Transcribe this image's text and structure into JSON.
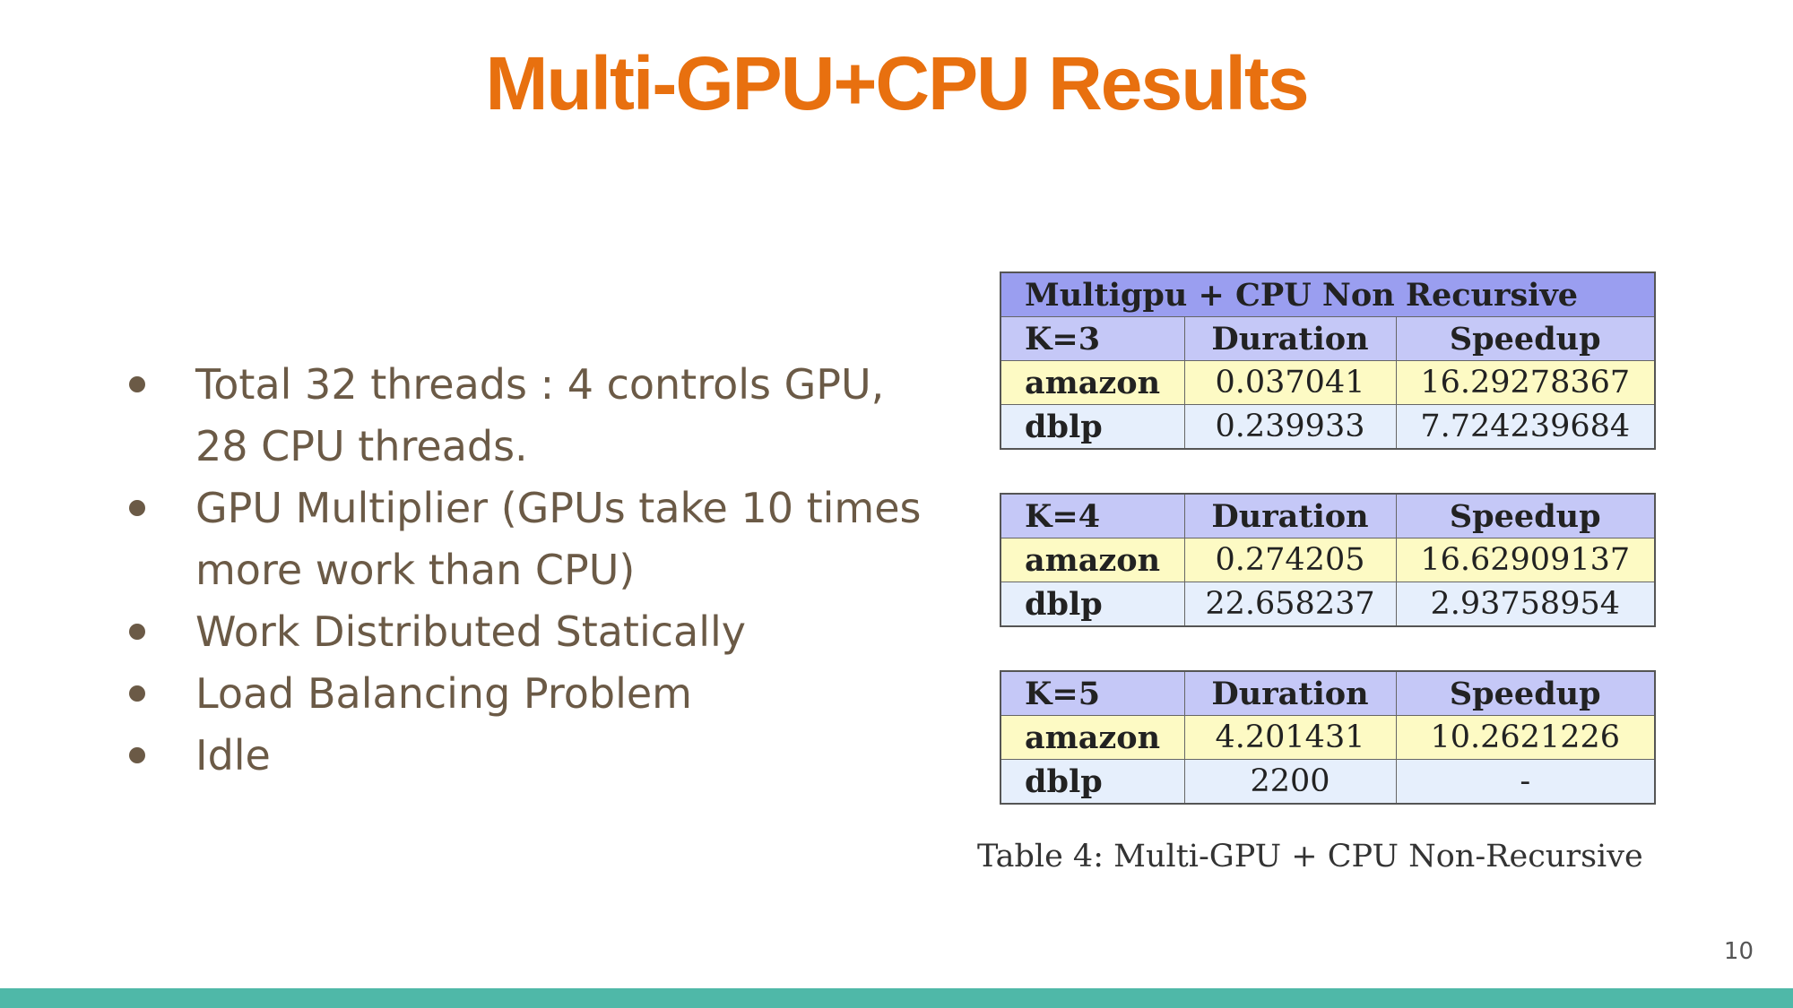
{
  "slide": {
    "title": "Multi-GPU+CPU Results",
    "page_number": "10"
  },
  "bullets": [
    "Total 32 threads : 4 controls GPU, 28 CPU threads.",
    "GPU Multiplier (GPUs take 10 times more work than CPU)",
    "Work Distributed Statically",
    "Load Balancing Problem",
    "Idle"
  ],
  "results_table": {
    "header_title": "Multigpu + CPU Non Recursive",
    "column_duration": "Duration",
    "column_speedup": "Speedup",
    "caption": "Table 4:  Multi-GPU + CPU Non-Recursive",
    "blocks": [
      {
        "k_label": "K=3",
        "rows": [
          {
            "dataset": "amazon",
            "duration": "0.037041",
            "speedup": "16.29278367"
          },
          {
            "dataset": "dblp",
            "duration": "0.239933",
            "speedup": "7.724239684"
          }
        ]
      },
      {
        "k_label": "K=4",
        "rows": [
          {
            "dataset": "amazon",
            "duration": "0.274205",
            "speedup": "16.62909137"
          },
          {
            "dataset": "dblp",
            "duration": "22.658237",
            "speedup": "2.93758954"
          }
        ]
      },
      {
        "k_label": "K=5",
        "rows": [
          {
            "dataset": "amazon",
            "duration": "4.201431",
            "speedup": "10.2621226"
          },
          {
            "dataset": "dblp",
            "duration": "2200",
            "speedup": "-"
          }
        ]
      }
    ]
  },
  "colors": {
    "title": "#e8700f",
    "bullet_text": "#6b5a46",
    "table_caption_bg": "#9a9ef0",
    "table_header_bg": "#c5c8f7",
    "amazon_row_bg": "#fdfac4",
    "dblp_row_bg": "#e6effc",
    "bottom_bar": "#4fb8a8"
  }
}
